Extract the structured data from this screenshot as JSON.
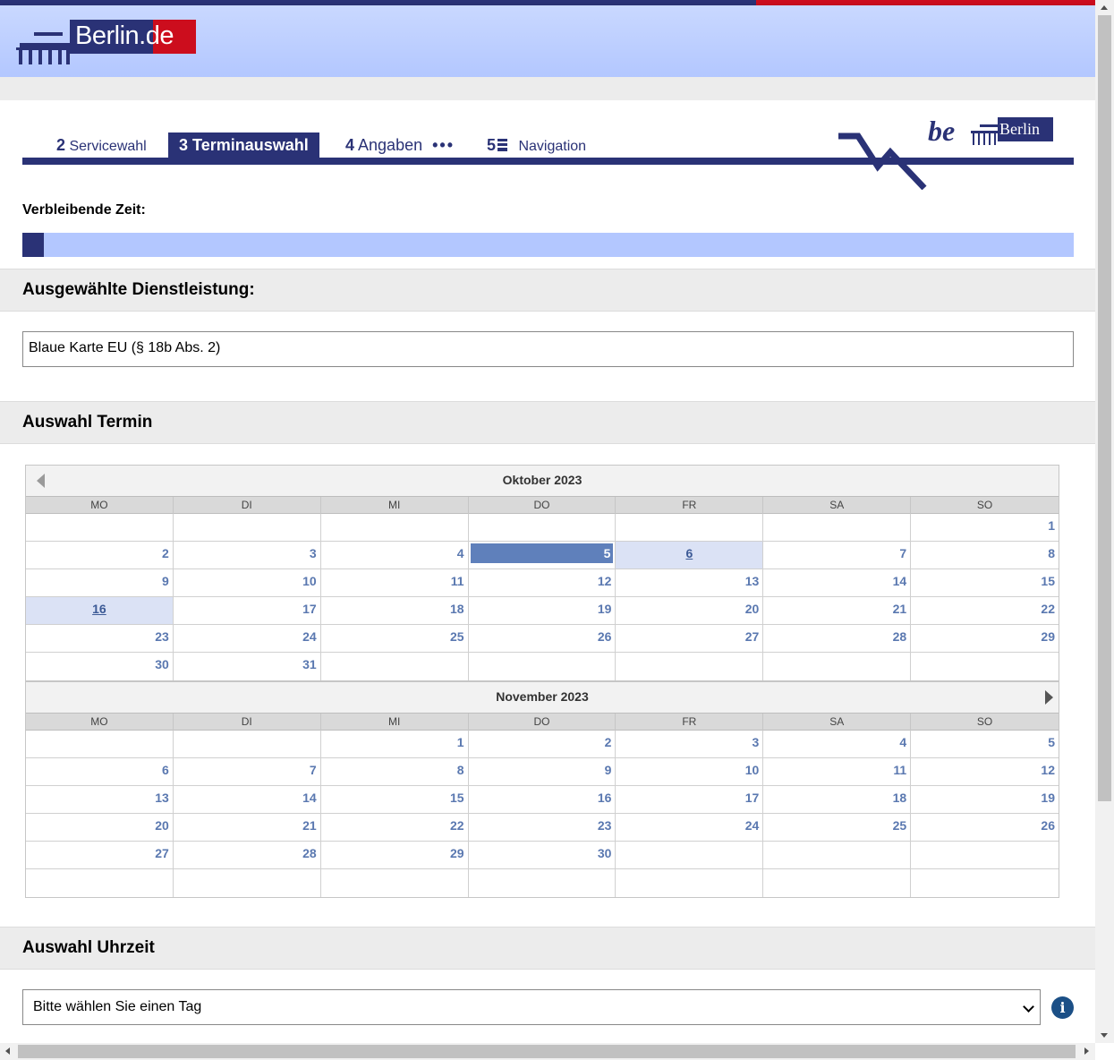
{
  "header": {
    "logo_text": "Berlin.de",
    "stripe_colors": {
      "blue": "#2a3276",
      "red": "#cc0d1d"
    }
  },
  "steps": [
    {
      "num": "2",
      "label": "Servicewahl"
    },
    {
      "num": "3",
      "label": "Terminauswahl"
    },
    {
      "num": "4",
      "label": "Angaben"
    },
    {
      "num": "5",
      "label": "Navigation"
    }
  ],
  "be_berlin_logo": {
    "be": "be",
    "berlin": "Berlin"
  },
  "timer": {
    "label": "Verbleibende Zeit:",
    "remaining_fraction": 0.02
  },
  "service": {
    "heading": "Ausgewählte Dienstleistung:",
    "value": "Blaue Karte EU (§ 18b Abs. 2)"
  },
  "calendar": {
    "heading": "Auswahl Termin",
    "weekdays": [
      "MO",
      "DI",
      "MI",
      "DO",
      "FR",
      "SA",
      "SO"
    ],
    "months": [
      {
        "title": "Oktober 2023",
        "weeks": [
          [
            "",
            "",
            "",
            "",
            "",
            "",
            "1"
          ],
          [
            "2",
            "3",
            "4",
            "5",
            "6",
            "7",
            "8"
          ],
          [
            "9",
            "10",
            "11",
            "12",
            "13",
            "14",
            "15"
          ],
          [
            "16",
            "17",
            "18",
            "19",
            "20",
            "21",
            "22"
          ],
          [
            "23",
            "24",
            "25",
            "26",
            "27",
            "28",
            "29"
          ],
          [
            "30",
            "31",
            "",
            "",
            "",
            "",
            ""
          ]
        ],
        "today": "5",
        "bookable": [
          "6",
          "16"
        ]
      },
      {
        "title": "November 2023",
        "weeks": [
          [
            "",
            "",
            "1",
            "2",
            "3",
            "4",
            "5"
          ],
          [
            "6",
            "7",
            "8",
            "9",
            "10",
            "11",
            "12"
          ],
          [
            "13",
            "14",
            "15",
            "16",
            "17",
            "18",
            "19"
          ],
          [
            "20",
            "21",
            "22",
            "23",
            "24",
            "25",
            "26"
          ],
          [
            "27",
            "28",
            "29",
            "30",
            "",
            "",
            ""
          ],
          [
            "",
            "",
            "",
            "",
            "",
            "",
            ""
          ]
        ],
        "today": "",
        "bookable": []
      }
    ],
    "colors": {
      "today": "#5f80bb",
      "bookable": "#dbe2f5",
      "day_text": "#5a78b0"
    }
  },
  "time_select": {
    "heading": "Auswahl Uhrzeit",
    "selected": "Bitte wählen Sie einen Tag",
    "info_icon": "i"
  }
}
